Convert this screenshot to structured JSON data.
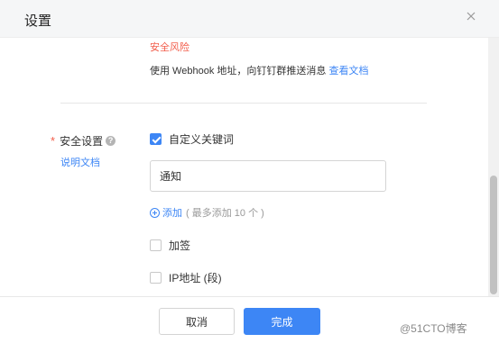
{
  "dialog": {
    "title": "设置",
    "close_icon": "close-icon"
  },
  "info": {
    "risk_text": "安全风险",
    "hint_text": "使用 Webhook 地址，向钉钉群推送消息",
    "hint_link": "查看文档"
  },
  "security": {
    "required_mark": "*",
    "label": "安全设置",
    "help_icon_glyph": "?",
    "doc_link": "说明文档",
    "custom_keyword": {
      "label": "自定义关键词",
      "checked": true
    },
    "keyword_input": {
      "value": "通知",
      "placeholder": ""
    },
    "add_label": "添加",
    "add_limit": "( 最多添加 10 个 )",
    "sign": {
      "label": "加签",
      "checked": false
    },
    "ip": {
      "label": "IP地址 (段)",
      "checked": false
    }
  },
  "footer": {
    "cancel_label": "取消",
    "ok_label": "完成"
  },
  "watermark": "@51CTO博客",
  "colors": {
    "accent": "#3d86f5",
    "danger": "#f25c4a"
  }
}
